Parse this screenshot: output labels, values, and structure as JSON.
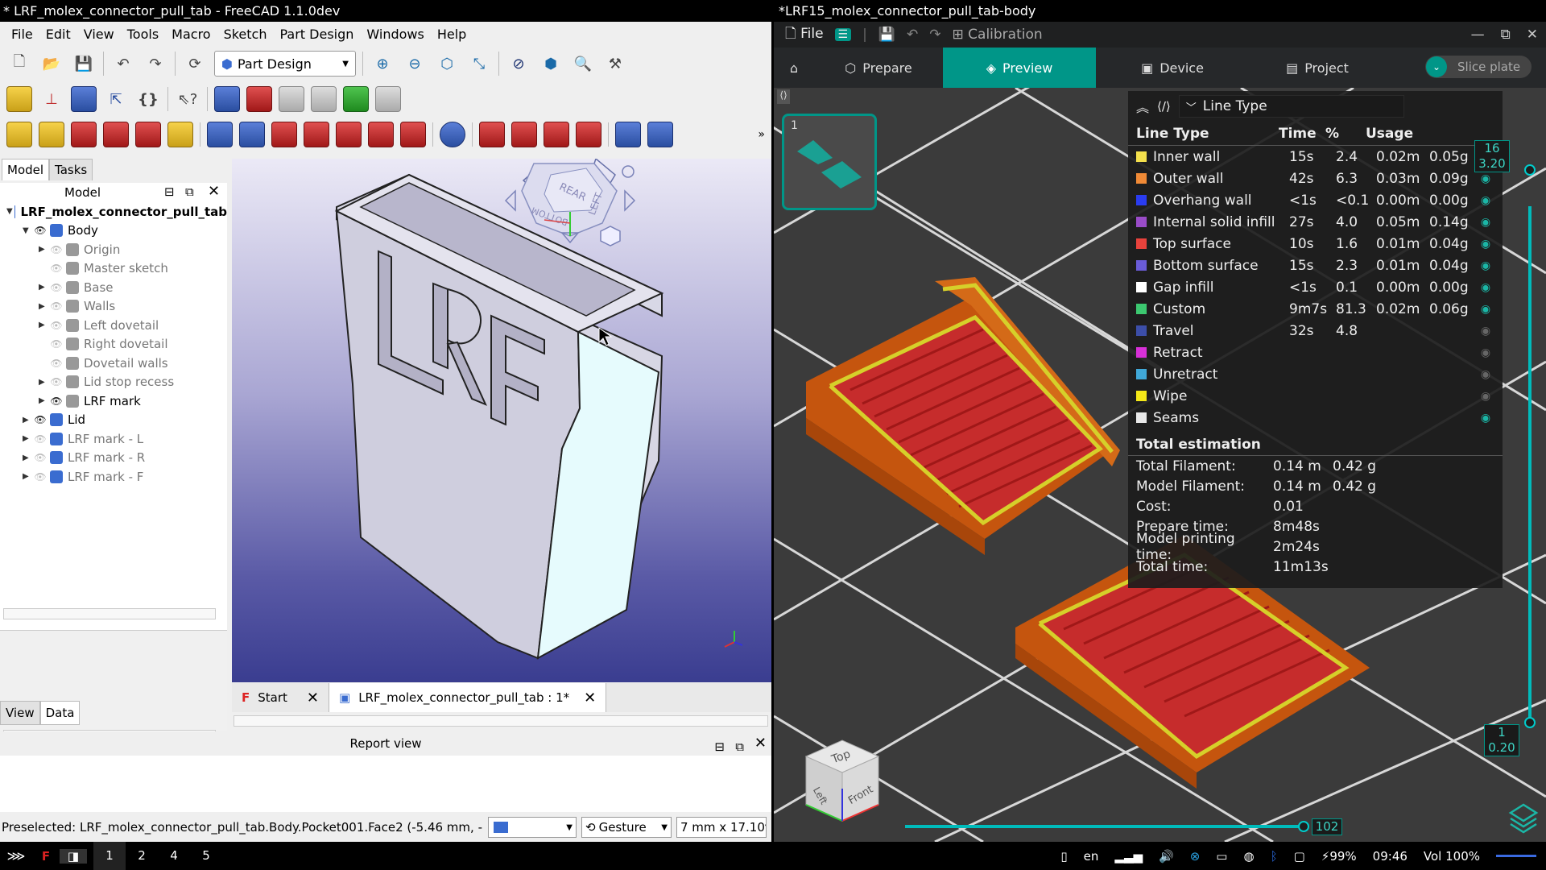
{
  "freecad": {
    "title": "* LRF_molex_connector_pull_tab - FreeCAD 1.1.0dev",
    "menu": [
      "File",
      "Edit",
      "View",
      "Tools",
      "Macro",
      "Sketch",
      "Part Design",
      "Windows",
      "Help"
    ],
    "workbench": "Part Design",
    "panel_tabs": [
      "Model",
      "Tasks"
    ],
    "panel_title": "Model",
    "tree": [
      {
        "label": "LRF_molex_connector_pull_tab",
        "depth": 0,
        "arrow": "▼",
        "eye": "",
        "bold": true
      },
      {
        "label": "Body",
        "depth": 1,
        "arrow": "▼",
        "eye": "on"
      },
      {
        "label": "Origin",
        "depth": 2,
        "arrow": "▶",
        "eye": "off"
      },
      {
        "label": "Master sketch",
        "depth": 2,
        "arrow": "",
        "eye": "off"
      },
      {
        "label": "Base",
        "depth": 2,
        "arrow": "▶",
        "eye": "off"
      },
      {
        "label": "Walls",
        "depth": 2,
        "arrow": "▶",
        "eye": "off"
      },
      {
        "label": "Left dovetail",
        "depth": 2,
        "arrow": "▶",
        "eye": "off"
      },
      {
        "label": "Right dovetail",
        "depth": 2,
        "arrow": "",
        "eye": "off"
      },
      {
        "label": "Dovetail walls",
        "depth": 2,
        "arrow": "",
        "eye": "off"
      },
      {
        "label": "Lid stop recess",
        "depth": 2,
        "arrow": "▶",
        "eye": "off"
      },
      {
        "label": "LRF mark",
        "depth": 2,
        "arrow": "▶",
        "eye": "on"
      },
      {
        "label": "Lid",
        "depth": 1,
        "arrow": "▶",
        "eye": "on"
      },
      {
        "label": "LRF mark - L",
        "depth": 1,
        "arrow": "▶",
        "eye": "off"
      },
      {
        "label": "LRF mark - R",
        "depth": 1,
        "arrow": "▶",
        "eye": "off"
      },
      {
        "label": "LRF mark - F",
        "depth": 1,
        "arrow": "▶",
        "eye": "off"
      }
    ],
    "bottom_tabs": [
      "View",
      "Data"
    ],
    "nav_cube": {
      "faces": [
        "REAR",
        "LEFT",
        "BOTTOM"
      ]
    },
    "doc_tabs": [
      {
        "label": "Start",
        "active": false
      },
      {
        "label": "LRF_molex_connector_pull_tab : 1*",
        "active": true
      }
    ],
    "report_title": "Report view",
    "status": "Preselected: LRF_molex_connector_pull_tab.Body.Pocket001.Face2 (-5.46 mm, -",
    "nav_style": "Gesture",
    "dimensions": "7 mm x 17.10"
  },
  "slicer": {
    "title": "*LRF15_molex_connector_pull_tab-body",
    "menu_file": "File",
    "calibration": "Calibration",
    "tabs": [
      {
        "label": "Prepare",
        "active": false
      },
      {
        "label": "Preview",
        "active": true
      },
      {
        "label": "Device",
        "active": false
      },
      {
        "label": "Project",
        "active": false
      }
    ],
    "slice_button": "Slice plate",
    "plate_number": "1",
    "legend_selector": "Line Type",
    "legend_cols": [
      "Line Type",
      "Time",
      "%",
      "Usage"
    ],
    "legend_rows": [
      {
        "name": "Inner wall",
        "color": "#f4e04c",
        "time": "15s",
        "pct": "2.4",
        "len": "0.02m",
        "g": "0.05g",
        "vis": true
      },
      {
        "name": "Outer wall",
        "color": "#f08a36",
        "time": "42s",
        "pct": "6.3",
        "len": "0.03m",
        "g": "0.09g",
        "vis": true
      },
      {
        "name": "Overhang wall",
        "color": "#2a3cf0",
        "time": "<1s",
        "pct": "<0.1",
        "len": "0.00m",
        "g": "0.00g",
        "vis": true
      },
      {
        "name": "Internal solid infill",
        "color": "#9a4cc8",
        "time": "27s",
        "pct": "4.0",
        "len": "0.05m",
        "g": "0.14g",
        "vis": true
      },
      {
        "name": "Top surface",
        "color": "#e8423c",
        "time": "10s",
        "pct": "1.6",
        "len": "0.01m",
        "g": "0.04g",
        "vis": true
      },
      {
        "name": "Bottom surface",
        "color": "#6a5cd8",
        "time": "15s",
        "pct": "2.3",
        "len": "0.01m",
        "g": "0.04g",
        "vis": true
      },
      {
        "name": "Gap infill",
        "color": "#ffffff",
        "time": "<1s",
        "pct": "0.1",
        "len": "0.00m",
        "g": "0.00g",
        "vis": true
      },
      {
        "name": "Custom",
        "color": "#3cc870",
        "time": "9m7s",
        "pct": "81.3",
        "len": "0.02m",
        "g": "0.06g",
        "vis": true
      },
      {
        "name": "Travel",
        "color": "#3c4ea8",
        "time": "32s",
        "pct": "4.8",
        "len": "",
        "g": "",
        "vis": false
      },
      {
        "name": "Retract",
        "color": "#d830d8",
        "time": "",
        "pct": "",
        "len": "",
        "g": "",
        "vis": false
      },
      {
        "name": "Unretract",
        "color": "#40a8d8",
        "time": "",
        "pct": "",
        "len": "",
        "g": "",
        "vis": false
      },
      {
        "name": "Wipe",
        "color": "#f4e818",
        "time": "",
        "pct": "",
        "len": "",
        "g": "",
        "vis": false
      },
      {
        "name": "Seams",
        "color": "#e8e8e8",
        "time": "",
        "pct": "",
        "len": "",
        "g": "",
        "vis": true
      }
    ],
    "total_title": "Total estimation",
    "totals": [
      {
        "k": "Total Filament:",
        "v1": "0.14 m",
        "v2": "0.42 g"
      },
      {
        "k": "Model Filament:",
        "v1": "0.14 m",
        "v2": "0.42 g"
      },
      {
        "k": "Cost:",
        "v1": "0.01",
        "v2": ""
      },
      {
        "k": "Prepare time:",
        "v1": "8m48s",
        "v2": ""
      },
      {
        "k": "Model printing time:",
        "v1": "2m24s",
        "v2": ""
      },
      {
        "k": "Total time:",
        "v1": "11m13s",
        "v2": ""
      }
    ],
    "layer_top": {
      "n": "16",
      "z": "3.20"
    },
    "layer_bottom": {
      "n": "1",
      "z": "0.20"
    },
    "move_value": "102",
    "view_cube": {
      "top": "Top",
      "left": "Left",
      "front": "Front"
    }
  },
  "taskbar": {
    "workspaces": [
      "1",
      "2",
      "4",
      "5"
    ],
    "active_ws": "1",
    "lang": "en",
    "battery": "99%",
    "clock": "09:46",
    "volume": "Vol 100%"
  }
}
